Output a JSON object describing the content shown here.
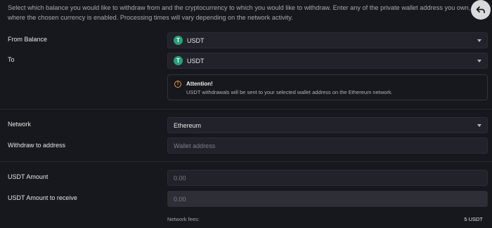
{
  "intro_text": "Select which balance you would like to withdraw from and the cryptocurrency to which you would like to withdraw. Enter any of the private wallet address you own, where the chosen currency is enabled. Processing times will vary depending on the network activity.",
  "form": {
    "from_balance": {
      "label": "From Balance",
      "value": "USDT",
      "icon": "T"
    },
    "to": {
      "label": "To",
      "value": "USDT",
      "icon": "T"
    },
    "notice": {
      "title": "Attention!",
      "text": "USDT withdrawals will be sent to your selected wallet address on the Ethereum network.",
      "icon": "!"
    },
    "network": {
      "label": "Network",
      "value": "Ethereum"
    },
    "withdraw_address": {
      "label": "Withdraw to address",
      "placeholder": "Wallet address"
    },
    "amount": {
      "label": "USDT Amount",
      "placeholder": "0.00"
    },
    "amount_receive": {
      "label": "USDT Amount to receive",
      "placeholder": "0.00"
    },
    "fees": {
      "label": "Network fees:",
      "value": "5 USDT"
    }
  },
  "colors": {
    "background": "#17181d",
    "field": "#22232a",
    "tether_green": "#26a17b",
    "warning": "#e8973b"
  }
}
